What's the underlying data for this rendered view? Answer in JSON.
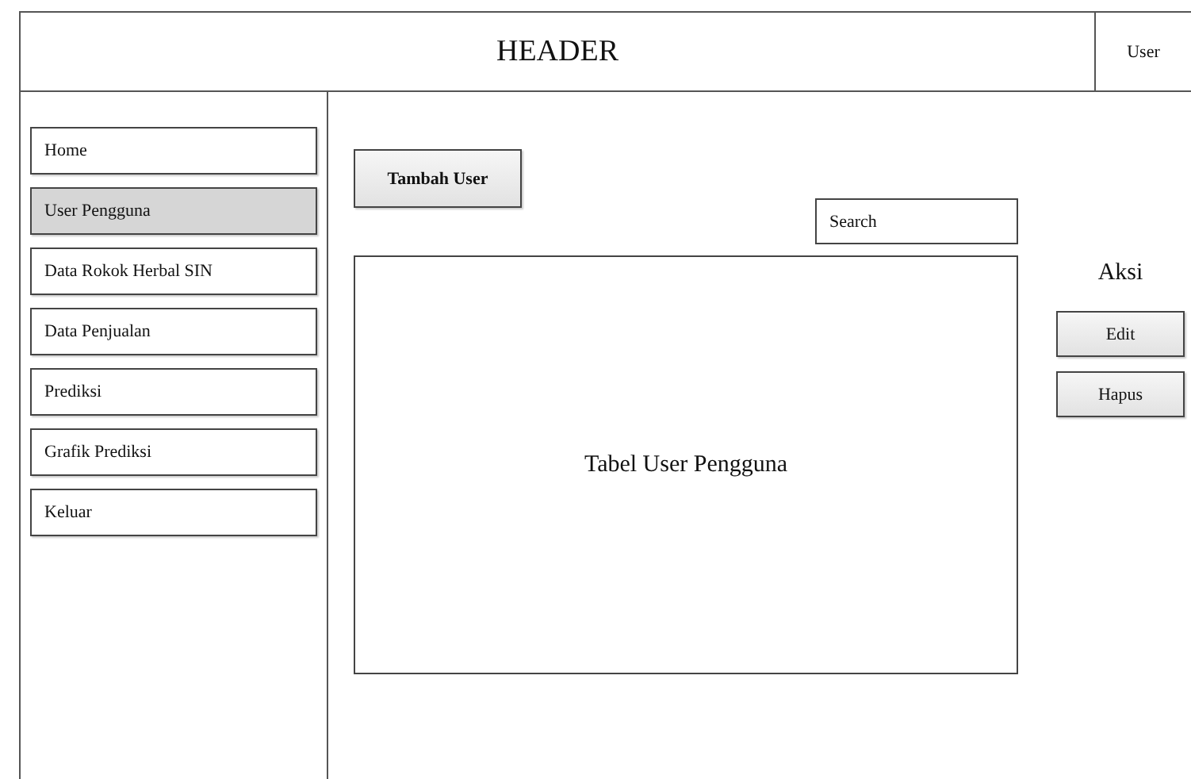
{
  "header": {
    "title": "HEADER",
    "user": "User"
  },
  "sidebar": {
    "items": [
      {
        "label": "Home",
        "selected": false
      },
      {
        "label": "User Pengguna",
        "selected": true
      },
      {
        "label": "Data Rokok Herbal SIN",
        "selected": false
      },
      {
        "label": "Data Penjualan",
        "selected": false
      },
      {
        "label": "Prediksi",
        "selected": false
      },
      {
        "label": "Grafik Prediksi",
        "selected": false
      },
      {
        "label": "Keluar",
        "selected": false
      }
    ]
  },
  "main": {
    "add_button": "Tambah User",
    "search": {
      "placeholder": "Search"
    },
    "table": {
      "title": "Tabel User Pengguna"
    },
    "actions": {
      "label": "Aksi",
      "buttons": [
        "Edit",
        "Hapus"
      ]
    }
  }
}
